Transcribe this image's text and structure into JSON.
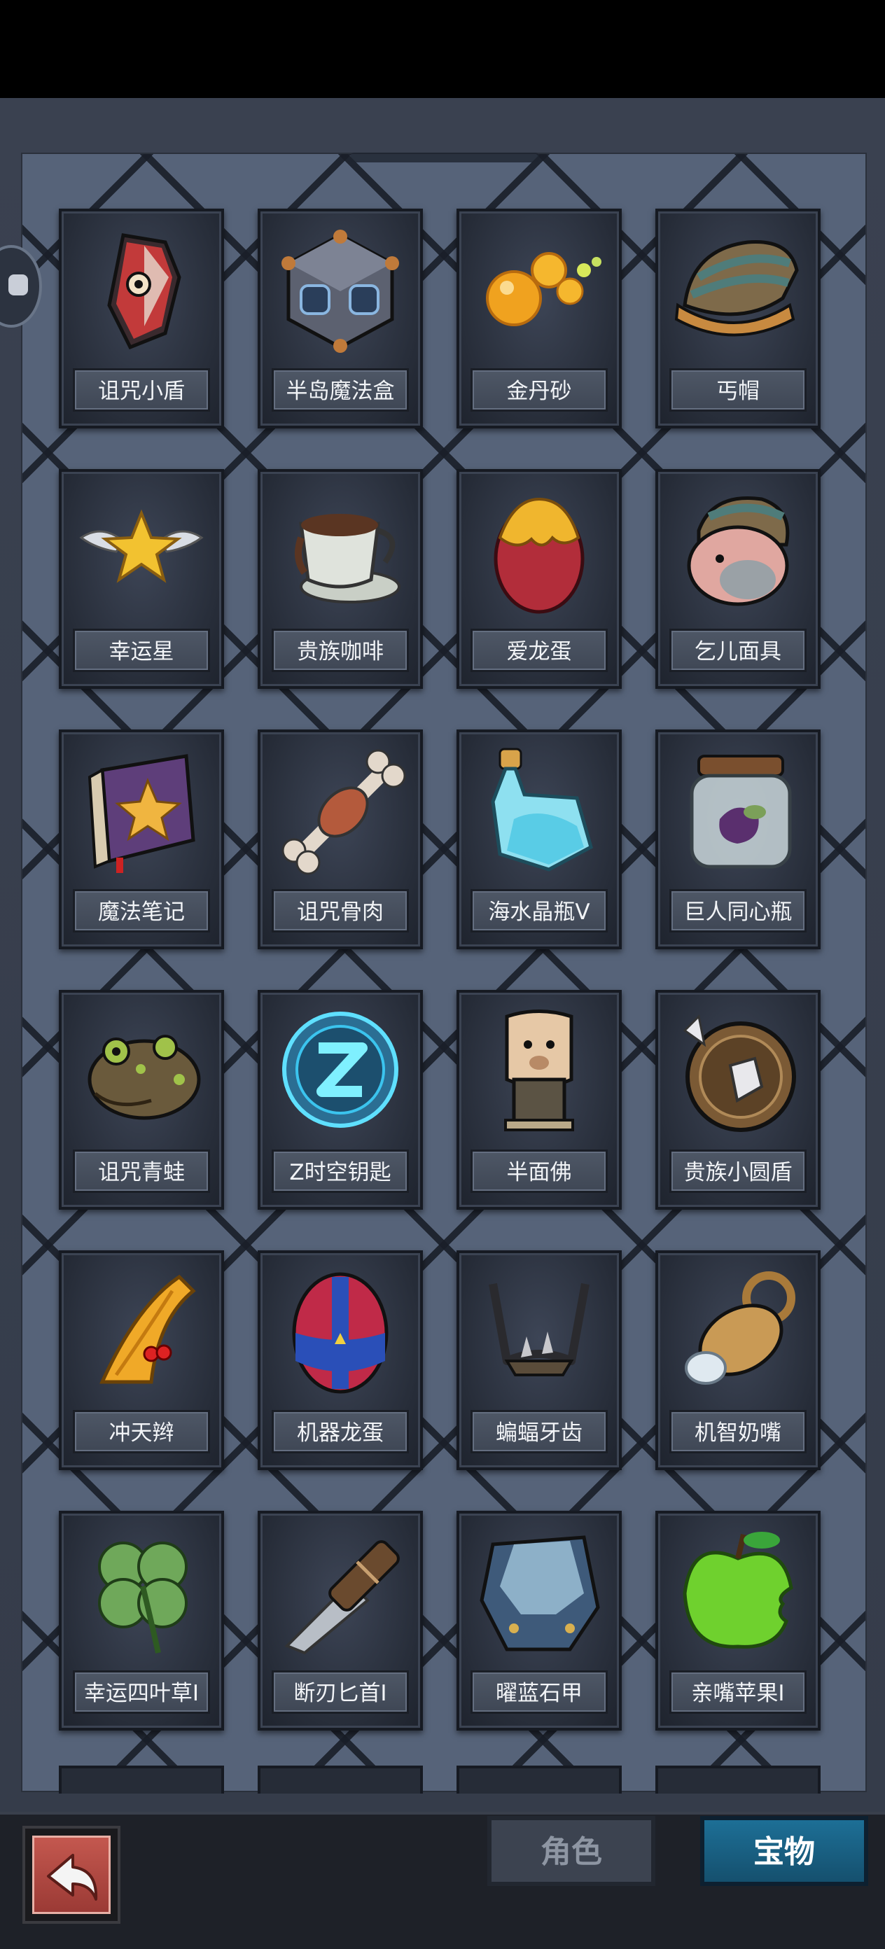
{
  "tabs": {
    "role": "角色",
    "treasure": "宝物",
    "active": "宝物"
  },
  "items": [
    {
      "name": "诅咒小盾",
      "icon": "cursed-small-shield-icon"
    },
    {
      "name": "半岛魔法盒",
      "icon": "peninsula-magic-box-icon"
    },
    {
      "name": "金丹砂",
      "icon": "golden-pill-sand-icon"
    },
    {
      "name": "丐帽",
      "icon": "beggar-hat-icon"
    },
    {
      "name": "幸运星",
      "icon": "lucky-star-icon"
    },
    {
      "name": "贵族咖啡",
      "icon": "noble-coffee-icon"
    },
    {
      "name": "爱龙蛋",
      "icon": "dragon-egg-icon"
    },
    {
      "name": "乞儿面具",
      "icon": "beggar-mask-icon"
    },
    {
      "name": "魔法笔记",
      "icon": "magic-notebook-icon"
    },
    {
      "name": "诅咒骨肉",
      "icon": "cursed-bone-meat-icon"
    },
    {
      "name": "海水晶瓶V",
      "icon": "sea-crystal-bottle-icon"
    },
    {
      "name": "巨人同心瓶",
      "icon": "giant-jar-icon"
    },
    {
      "name": "诅咒青蛙",
      "icon": "cursed-frog-icon"
    },
    {
      "name": "Z时空钥匙",
      "icon": "z-spacetime-key-icon"
    },
    {
      "name": "半面佛",
      "icon": "half-buddha-icon"
    },
    {
      "name": "贵族小圆盾",
      "icon": "noble-round-shield-icon"
    },
    {
      "name": "冲天辫",
      "icon": "pigtail-icon"
    },
    {
      "name": "机器龙蛋",
      "icon": "mech-dragon-egg-icon"
    },
    {
      "name": "蝙蝠牙齿",
      "icon": "bat-teeth-icon"
    },
    {
      "name": "机智奶嘴",
      "icon": "pacifier-icon"
    },
    {
      "name": "幸运四叶草I",
      "icon": "four-leaf-clover-icon"
    },
    {
      "name": "断刃匕首I",
      "icon": "broken-dagger-icon"
    },
    {
      "name": "曜蓝石甲",
      "icon": "blue-stone-armor-icon"
    },
    {
      "name": "亲嘴苹果I",
      "icon": "bitten-apple-icon"
    }
  ]
}
